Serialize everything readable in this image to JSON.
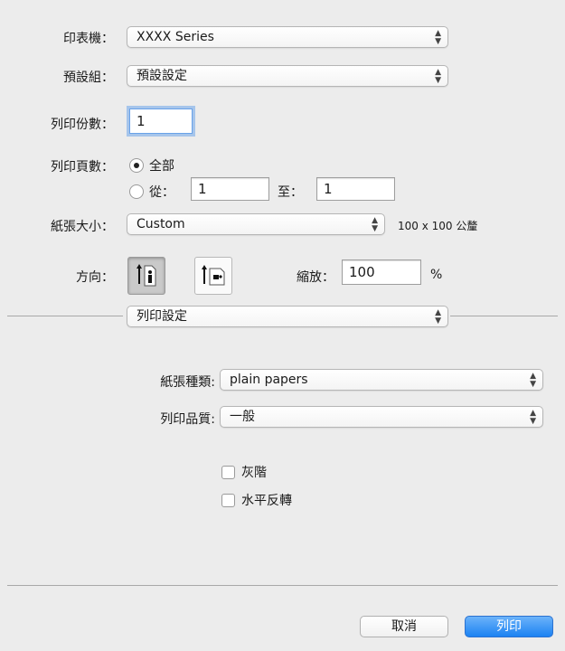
{
  "printer": {
    "label": "印表機：",
    "value": "XXXX Series"
  },
  "presets": {
    "label": "預設組：",
    "value": "預設設定"
  },
  "copies": {
    "label": "列印份數：",
    "value": "1"
  },
  "pages": {
    "label": "列印頁數：",
    "all_label": "全部",
    "from_label": "從：",
    "from_value": "1",
    "to_label": "至：",
    "to_value": "1"
  },
  "paper_size": {
    "label": "紙張大小：",
    "value": "Custom",
    "dimensions": "100 x 100 公釐"
  },
  "orientation": {
    "label": "方向：",
    "selected": "portrait"
  },
  "scale": {
    "label": "縮放：",
    "value": "100",
    "unit": "%"
  },
  "section_popup": {
    "value": "列印設定"
  },
  "media_type": {
    "label": "紙張種類:",
    "value": "plain papers"
  },
  "print_quality": {
    "label": "列印品質:",
    "value": "一般"
  },
  "options": {
    "grayscale_label": "灰階",
    "mirror_label": "水平反轉"
  },
  "buttons": {
    "cancel": "取消",
    "print": "列印"
  },
  "colors": {
    "accent": "#1c82f2",
    "background": "#ececec"
  }
}
